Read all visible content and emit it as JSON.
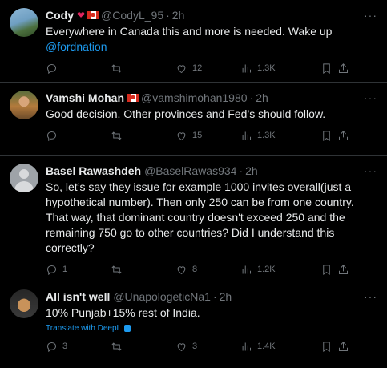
{
  "tweets": [
    {
      "name": "Cody",
      "handle": "@CodyL_95",
      "time": "2h",
      "text": "Everywhere in Canada this and more is needed. Wake up",
      "mention": "@fordnation",
      "replies": "",
      "retweets": "",
      "likes": "12",
      "views": "1.3K"
    },
    {
      "name": "Vamshi Mohan",
      "handle": "@vamshimohan1980",
      "time": "2h",
      "text": "Good decision. Other provinces and Fed’s  should follow.",
      "replies": "",
      "retweets": "",
      "likes": "15",
      "views": "1.3K"
    },
    {
      "name": "Basel Rawashdeh",
      "handle": "@BaselRawas934",
      "time": "2h",
      "text": "So, let’s say they issue for example 1000 invites overall(just a hypothetical number). Then only 250 can be from one country. That way, that dominant country doesn't exceed 250 and the remaining 750 go to other countries? Did I understand this correctly?",
      "replies": "1",
      "retweets": "",
      "likes": "8",
      "views": "1.2K"
    },
    {
      "name": "All isn't well",
      "handle": "@UnapologeticNa1",
      "time": "2h",
      "text": "10% Punjab+15% rest of India.",
      "translate": "Translate with DeepL",
      "replies": "3",
      "retweets": "",
      "likes": "3",
      "views": "1.4K"
    }
  ],
  "sep": "·",
  "more": "···",
  "icons": {
    "reply": "reply-icon",
    "retweet": "retweet-icon",
    "like": "like-icon",
    "views": "views-icon",
    "bookmark": "bookmark-icon",
    "share": "share-icon"
  },
  "colors": {
    "background": "#000000",
    "text": "#e7e9ea",
    "muted": "#71767b",
    "link": "#1d9bf0",
    "border": "#2f3336"
  }
}
